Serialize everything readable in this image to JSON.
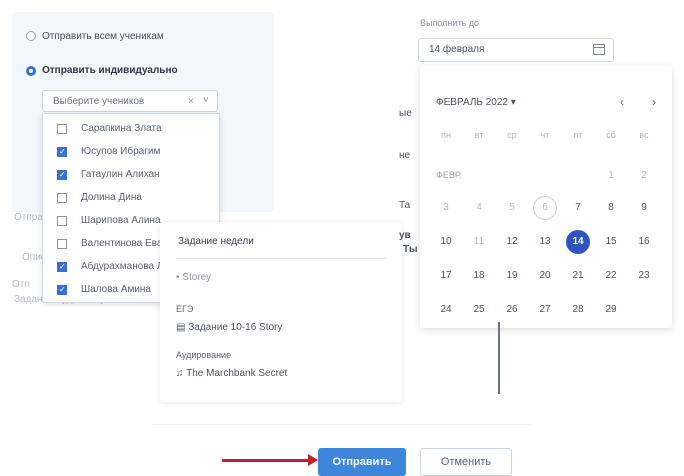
{
  "recipients": {
    "option_all": "Отправить всем ученикам",
    "option_individual": "Отправить индивидуально",
    "select_placeholder": "Выберите учеников",
    "clear_symbol": "×",
    "chevron_symbol": "˅",
    "students": [
      {
        "name": "Сарапкина Злата",
        "checked": false
      },
      {
        "name": "Юсупов Ибрагим",
        "checked": true
      },
      {
        "name": "Гатаулин Алихан",
        "checked": true
      },
      {
        "name": "Долина Дина",
        "checked": false
      },
      {
        "name": "Шарипова Алина",
        "checked": false
      },
      {
        "name": "Валентинова Ева",
        "checked": false
      },
      {
        "name": "Абдурахманова Лейла",
        "checked": true
      },
      {
        "name": "Шалова Амина",
        "checked": true
      }
    ],
    "behind_text_1": "Отправ",
    "behind_text_2": "Описа",
    "behind_text_3": "Отп",
    "behind_text_4": "Задание будет отправлено"
  },
  "popover": {
    "title": "Задание недели",
    "author": "• Storey",
    "section_ege": "ЕГЭ",
    "ege_item": "Задание 10-16 Story",
    "section_audio": "Аудирование",
    "audio_item": "The Marchbank Secret"
  },
  "deadline": {
    "label": "Выполнить до",
    "value": "14 февраля"
  },
  "calendar": {
    "month_title": "ФЕВРАЛЬ 2022",
    "title_caret": "▾",
    "prev": "‹",
    "next": "›",
    "weekdays": [
      "пн",
      "вт",
      "ср",
      "чт",
      "пт",
      "сб",
      "вс"
    ],
    "month_short": "ФЕВР.",
    "row1": [
      "",
      "1",
      "2"
    ],
    "rows": [
      [
        "3",
        "4",
        "5",
        "6",
        "7",
        "8",
        "9"
      ],
      [
        "10",
        "11",
        "12",
        "13",
        "14",
        "15",
        "16"
      ],
      [
        "17",
        "18",
        "19",
        "20",
        "21",
        "22",
        "23"
      ],
      [
        "24",
        "25",
        "26",
        "27",
        "28",
        "29",
        ""
      ]
    ],
    "selected_day": "14",
    "today_day": "6"
  },
  "side_texts": {
    "t1": "ые",
    "t2": "не",
    "t3": "Та",
    "t4": "ув",
    "t5": "Ты"
  },
  "footer": {
    "send_label": "Отправить",
    "cancel_label": "Отменить"
  },
  "colors": {
    "accent": "#3d86dc",
    "selected_day": "#2f54c2",
    "arrow": "#c21f2c"
  }
}
